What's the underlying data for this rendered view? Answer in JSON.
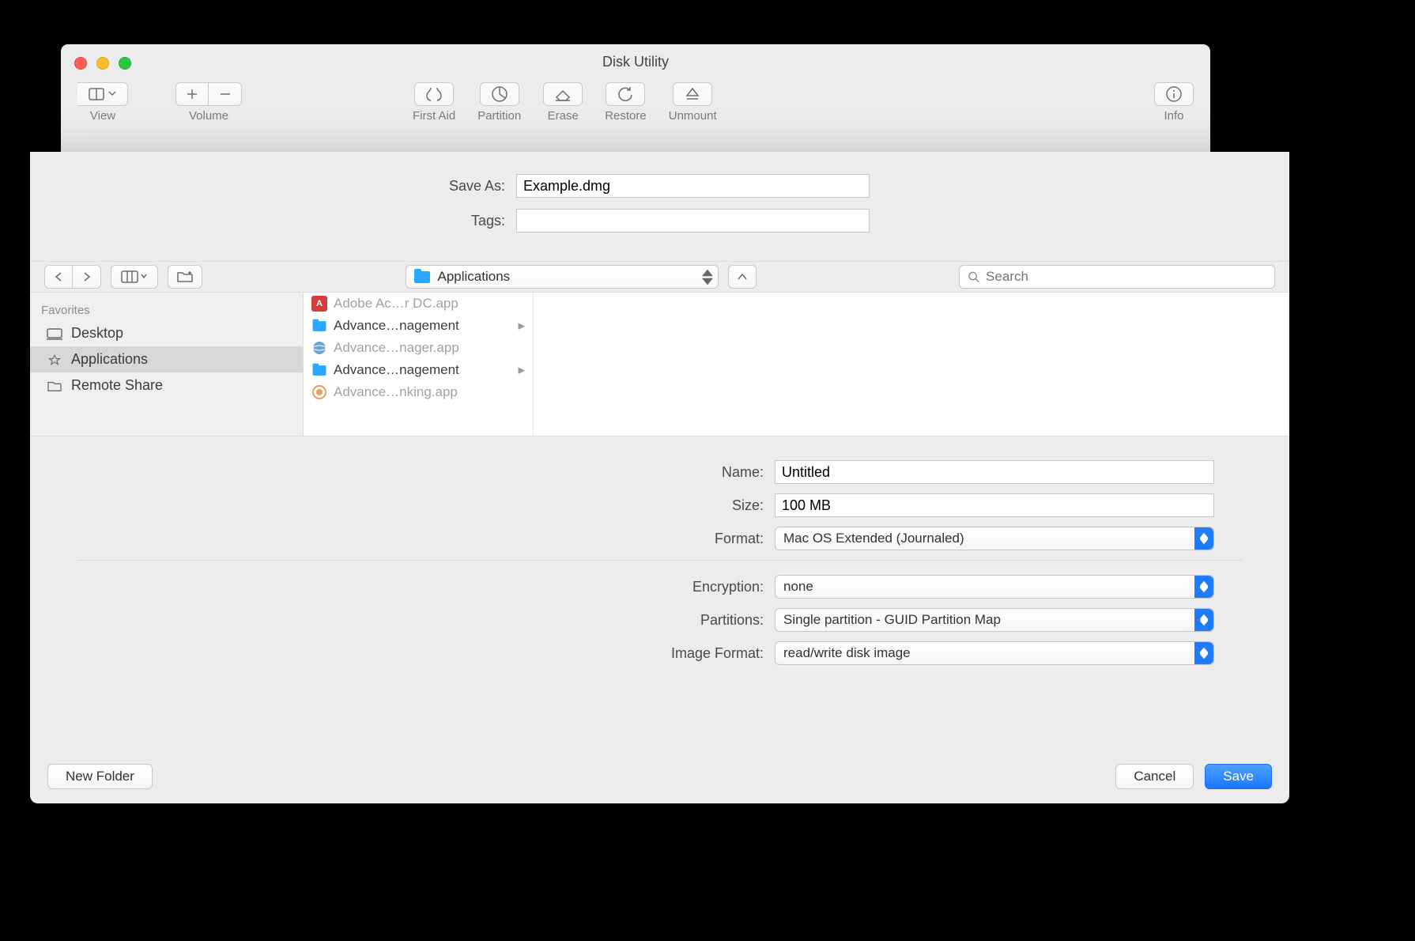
{
  "window": {
    "title": "Disk Utility",
    "toolbar": {
      "view": "View",
      "volume": "Volume",
      "first_aid": "First Aid",
      "partition": "Partition",
      "erase": "Erase",
      "restore": "Restore",
      "unmount": "Unmount",
      "info": "Info"
    }
  },
  "sheet": {
    "save_as_label": "Save As:",
    "save_as_value": "Example.dmg",
    "tags_label": "Tags:",
    "tags_value": "",
    "location": "Applications",
    "search_placeholder": "Search"
  },
  "sidebar": {
    "heading": "Favorites",
    "items": [
      {
        "label": "Desktop"
      },
      {
        "label": "Applications"
      },
      {
        "label": "Remote Share"
      }
    ],
    "selected_index": 1
  },
  "column": {
    "items": [
      {
        "label": "Adobe Ac…r DC.app",
        "icon": "pdf",
        "dim": true,
        "folder": false
      },
      {
        "label": "Advance…nagement",
        "icon": "folder",
        "dim": false,
        "folder": true
      },
      {
        "label": "Advance…nager.app",
        "icon": "globe",
        "dim": true,
        "folder": false
      },
      {
        "label": "Advance…nagement",
        "icon": "folder",
        "dim": false,
        "folder": true
      },
      {
        "label": "Advance…nking.app",
        "icon": "globe-o",
        "dim": true,
        "folder": false
      }
    ]
  },
  "form": {
    "name_label": "Name:",
    "name_value": "Untitled",
    "size_label": "Size:",
    "size_value": "100 MB",
    "format_label": "Format:",
    "format_value": "Mac OS Extended (Journaled)",
    "encryption_label": "Encryption:",
    "encryption_value": "none",
    "partitions_label": "Partitions:",
    "partitions_value": "Single partition - GUID Partition Map",
    "image_format_label": "Image Format:",
    "image_format_value": "read/write disk image"
  },
  "footer": {
    "new_folder": "New Folder",
    "cancel": "Cancel",
    "save": "Save"
  }
}
